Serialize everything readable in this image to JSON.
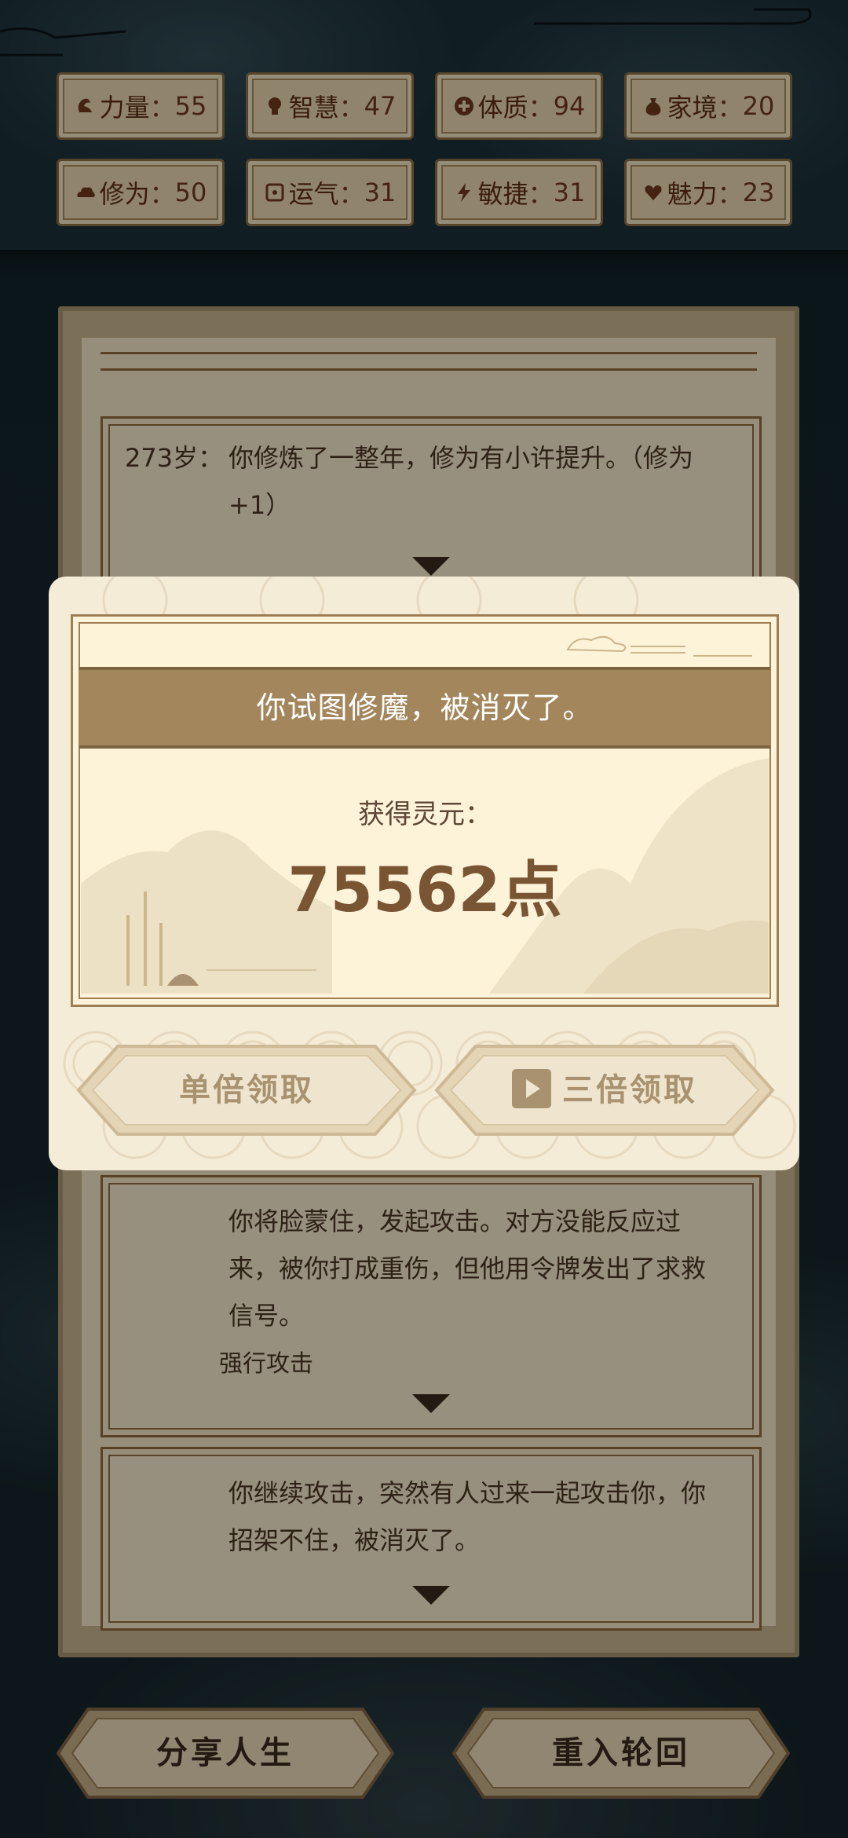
{
  "stats": [
    {
      "label": "力量",
      "value": "55",
      "icon": "strength-icon"
    },
    {
      "label": "智慧",
      "value": "47",
      "icon": "bulb-icon"
    },
    {
      "label": "体质",
      "value": "94",
      "icon": "cross-icon"
    },
    {
      "label": "家境",
      "value": "20",
      "icon": "money-bag-icon"
    },
    {
      "label": "修为",
      "value": "50",
      "icon": "cloud-icon"
    },
    {
      "label": "运气",
      "value": "31",
      "icon": "dice-icon"
    },
    {
      "label": "敏捷",
      "value": "31",
      "icon": "lightning-icon"
    },
    {
      "label": "魅力",
      "value": "23",
      "icon": "heart-icon"
    }
  ],
  "stat_separator": "：",
  "story": [
    {
      "age": "273岁：",
      "text": "你修炼了一整年，修为有小许提升。（修为+1）"
    },
    {
      "text": "你将脸蒙住，发起攻击。对方没能反应过来，被你打成重伤，但他用令牌发出了求救信号。",
      "choice": "强行攻击"
    },
    {
      "text": "你继续攻击，突然有人过来一起攻击你，你招架不住，被消灭了。"
    }
  ],
  "modal": {
    "title": "你试图修魔，被消灭了。",
    "reward_label": "获得灵元：",
    "reward_value": "75562点",
    "single_button": "单倍领取",
    "triple_button": "三倍领取"
  },
  "bottom": {
    "share_button": "分享人生",
    "restart_button": "重入轮回"
  },
  "colors": {
    "stat_bg": "#e9d6b0",
    "stat_text": "#6f3a1c",
    "banner": "#a3865b",
    "reward_text": "#7a5533",
    "disabled_button_text": "#a8926f"
  }
}
